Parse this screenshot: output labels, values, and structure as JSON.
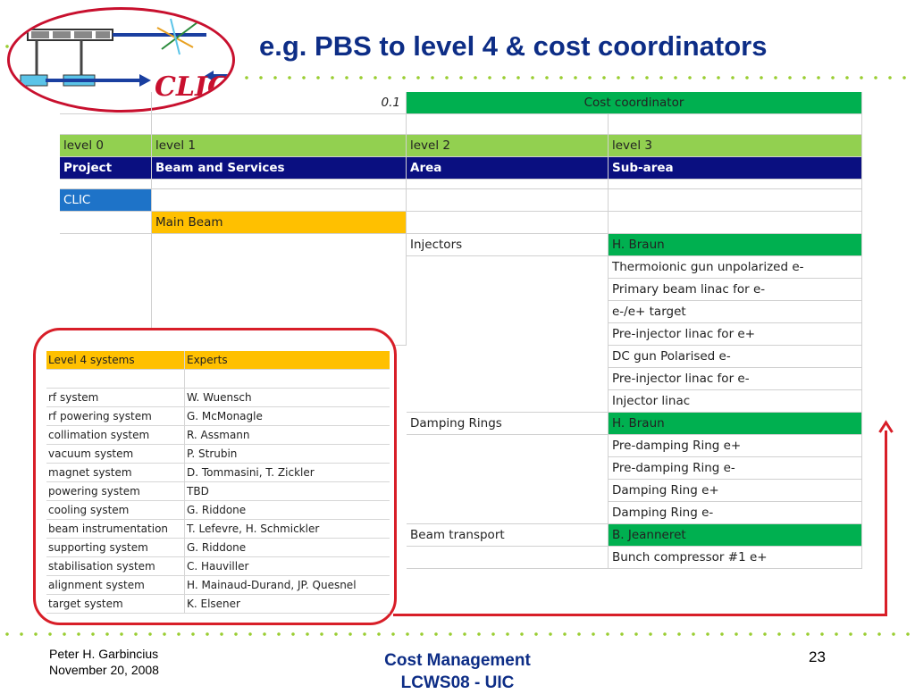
{
  "logo": {
    "text": "CLIC"
  },
  "title": "e.g. PBS to level 4 & cost coordinators",
  "pbs": {
    "top_value": "0.1",
    "cost_coordinator": "Cost coordinator",
    "levels": [
      "level 0",
      "level 1",
      "level 2",
      "level 3"
    ],
    "headers": [
      "Project",
      "Beam and Services",
      "Area",
      "Sub-area"
    ],
    "project": "CLIC",
    "level1_item": "Main Beam",
    "areas": [
      {
        "name": "Injectors",
        "coordinator": "H. Braun",
        "subareas": [
          "Thermoionic gun unpolarized e-",
          "Primary beam linac for e-",
          "e-/e+ target",
          "Pre-injector linac for e+",
          "DC gun Polarised e-",
          "Pre-injector linac for e-",
          "Injector linac"
        ]
      },
      {
        "name": "Damping Rings",
        "coordinator": "H. Braun",
        "subareas": [
          "Pre-damping Ring e+",
          "Pre-damping Ring e-",
          "Damping Ring e+",
          "Damping Ring e-"
        ]
      },
      {
        "name": "Beam transport",
        "coordinator": "B. Jeanneret",
        "subareas": [
          "Bunch compressor #1 e+"
        ]
      }
    ]
  },
  "level4": {
    "header": [
      "Level 4 systems",
      "Experts"
    ],
    "rows": [
      [
        "rf system",
        "W. Wuensch"
      ],
      [
        "rf powering system",
        "G. McMonagle"
      ],
      [
        "collimation system",
        "R. Assmann"
      ],
      [
        "vacuum system",
        "P. Strubin"
      ],
      [
        "magnet system",
        "D. Tommasini, T. Zickler"
      ],
      [
        "powering system",
        "TBD"
      ],
      [
        "cooling system",
        "G. Riddone"
      ],
      [
        "beam instrumentation",
        "T. Lefevre, H. Schmickler"
      ],
      [
        "supporting system",
        "G. Riddone"
      ],
      [
        "stabilisation system",
        "C. Hauviller"
      ],
      [
        "alignment system",
        "H. Mainaud-Durand, JP. Quesnel"
      ],
      [
        "target system",
        "K. Elsener"
      ]
    ]
  },
  "footer": {
    "author": "Peter H. Garbincius",
    "date": "November 20, 2008",
    "center_line1": "Cost Management",
    "center_line2": "LCWS08 - UIC",
    "page": "23"
  },
  "colors": {
    "title": "#0d2d86",
    "green": "#00b050",
    "light_green": "#92d050",
    "navy": "#0a0f80",
    "blue": "#1e73c8",
    "yellow": "#ffc000",
    "red": "#d81e28"
  }
}
